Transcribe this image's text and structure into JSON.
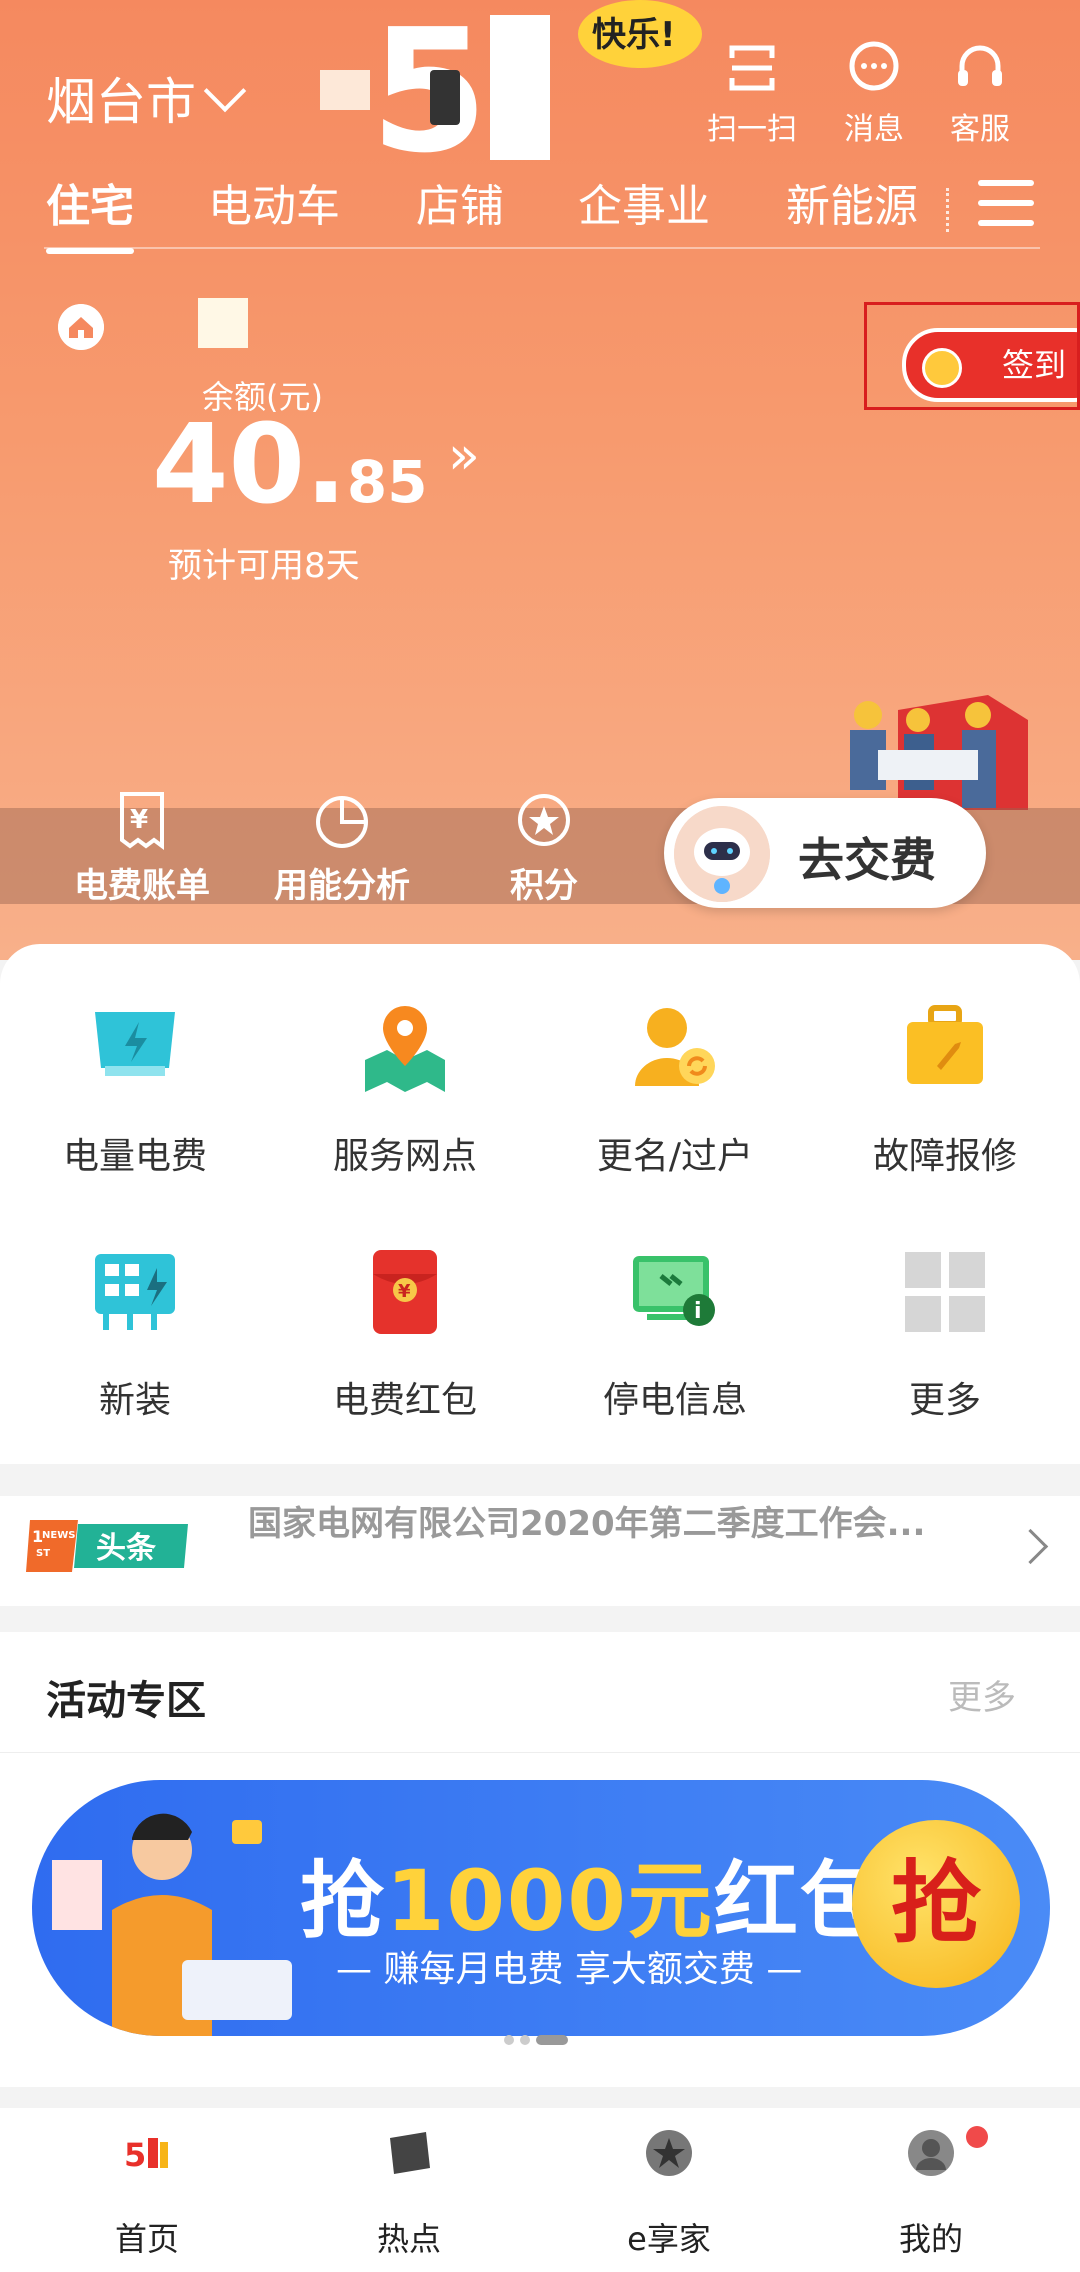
{
  "header": {
    "city": "烟台市",
    "banner_text": "快乐!",
    "scan_label": "扫一扫",
    "message_label": "消息",
    "service_label": "客服"
  },
  "tabs": [
    "住宅",
    "电动车",
    "店铺",
    "企事业",
    "新能源"
  ],
  "account": {
    "balance_label": "余额(元)",
    "balance_int": "40.",
    "balance_dec": "85",
    "estimate": "预计可用8天",
    "signin_label": "签到"
  },
  "quick": {
    "bill": "电费账单",
    "analysis": "用能分析",
    "points": "积分",
    "pay": "去交费"
  },
  "services": [
    {
      "label": "电量电费",
      "icon": "electric-fee-icon"
    },
    {
      "label": "服务网点",
      "icon": "map-pin-icon"
    },
    {
      "label": "更名/过户",
      "icon": "user-transfer-icon"
    },
    {
      "label": "故障报修",
      "icon": "toolbox-icon"
    },
    {
      "label": "新装",
      "icon": "new-install-icon"
    },
    {
      "label": "电费红包",
      "icon": "red-envelope-icon"
    },
    {
      "label": "停电信息",
      "icon": "outage-info-icon"
    },
    {
      "label": "更多",
      "icon": "more-grid-icon"
    }
  ],
  "news": {
    "badge": "头条",
    "headline": "国家电网有限公司2020年第二季度工作会..."
  },
  "activities": {
    "title": "活动专区",
    "more": "更多",
    "promo_prefix": "抢",
    "promo_highlight": "1000元",
    "promo_suffix": "红包",
    "promo_sub": "— 赚每月电费 享大额交费 —",
    "promo_button": "抢"
  },
  "bottom_nav": [
    "首页",
    "热点",
    "e享家",
    "我的"
  ],
  "colors": {
    "hero": "#f5895f",
    "accent_red": "#e8302a",
    "promo_blue": "#2f6cf0"
  }
}
